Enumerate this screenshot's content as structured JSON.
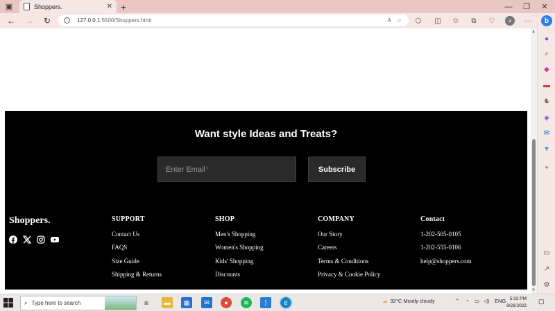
{
  "browser": {
    "tab_title": "Shoppers.",
    "url_host": "127.0.0.1",
    "url_path": ":5500/Shoppers.html",
    "close_tab": "✕",
    "new_tab": "+",
    "back": "←",
    "forward": "→",
    "reload": "↻",
    "read_aloud": "A",
    "minimize": "—",
    "maximize": "❐",
    "close_window": "✕",
    "more": "···"
  },
  "footer": {
    "newsletter_title": "Want style Ideas and Treats?",
    "email_placeholder": "Enter Email",
    "email_required_mark": "*",
    "subscribe_label": "Subscribe",
    "brand": "Shoppers.",
    "social_icons": [
      "facebook-icon",
      "x-icon",
      "instagram-icon",
      "youtube-icon"
    ],
    "columns": [
      {
        "title": "SUPPORT",
        "items": [
          "Contact Us",
          "FAQS",
          "Size Guide",
          "Shipping & Returns"
        ]
      },
      {
        "title": "SHOP",
        "items": [
          "Men's Shopping",
          "Women's Shopping",
          "Kids' Shopping",
          "Discounts"
        ]
      },
      {
        "title": "COMPANY",
        "items": [
          "Our Story",
          "Careers",
          "Terms & Conditions",
          "Privacy & Cookie Policy"
        ]
      },
      {
        "title": "Contact",
        "items": [
          "1-202-505-0105",
          "1-202-555-0106",
          "help@shoppers.com"
        ]
      }
    ]
  },
  "taskbar": {
    "search_placeholder": "Type here to search",
    "weather": "32°C  Mostly cloudy",
    "language": "ENG",
    "time": "5:33 PM",
    "date": "9/26/2023"
  },
  "colors": {
    "footer_bg": "#000000",
    "field_bg": "#2a2a2a",
    "chrome_tab": "#e9c6c2"
  }
}
